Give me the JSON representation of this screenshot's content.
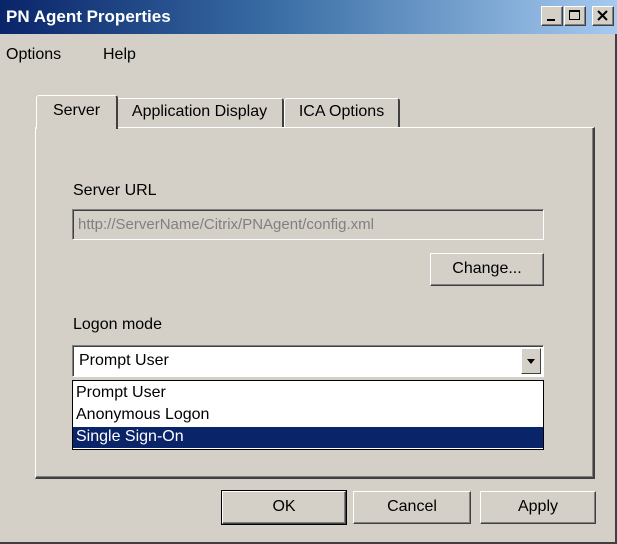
{
  "window": {
    "title": "PN Agent Properties"
  },
  "menu": {
    "items": [
      "Options",
      "Help"
    ]
  },
  "tabs": [
    "Server",
    "Application Display",
    "ICA Options"
  ],
  "server": {
    "url_label": "Server URL",
    "url_value": "http://ServerName/Citrix/PNAgent/config.xml",
    "change_button": "Change...",
    "logon_label": "Logon mode",
    "logon_selected": "Prompt User",
    "logon_options": [
      "Prompt User",
      "Anonymous Logon",
      "Single Sign-On"
    ],
    "highlighted_option": "Single Sign-On"
  },
  "buttons": {
    "ok": "OK",
    "cancel": "Cancel",
    "apply": "Apply"
  },
  "colors": {
    "selection": "#0a246a",
    "face": "#d4d0c8"
  }
}
